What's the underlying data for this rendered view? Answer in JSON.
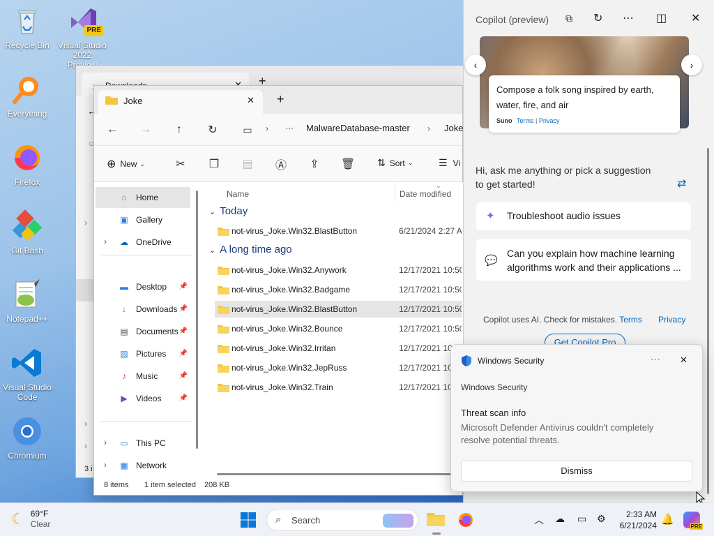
{
  "desktop": {
    "icons": [
      {
        "label": "Recycle Bin"
      },
      {
        "label": "Visual Studio 2022 Preview",
        "badge": "PRE"
      },
      {
        "label": "Everything"
      },
      {
        "label": "Firefox"
      },
      {
        "label": "Git Bash"
      },
      {
        "label": "Notepad++"
      },
      {
        "label": "Visual Studio Code"
      },
      {
        "label": "Chromium"
      }
    ]
  },
  "explorer_back": {
    "tab_title": "Downloads",
    "status_partial": "3 i"
  },
  "explorer": {
    "tab_title": "Joke",
    "breadcrumb": {
      "more": "···",
      "items": [
        "MalwareDatabase-master",
        "Joke"
      ]
    },
    "commands": {
      "new": "New",
      "sort": "Sort",
      "view": "Vi"
    },
    "nav": [
      {
        "label": "Home",
        "selected": true
      },
      {
        "label": "Gallery"
      },
      {
        "label": "OneDrive"
      },
      {
        "label": "Desktop",
        "pinned": true
      },
      {
        "label": "Downloads",
        "pinned": true
      },
      {
        "label": "Documents",
        "pinned": true
      },
      {
        "label": "Pictures",
        "pinned": true
      },
      {
        "label": "Music",
        "pinned": true
      },
      {
        "label": "Videos",
        "pinned": true
      },
      {
        "label": "This PC"
      },
      {
        "label": "Network"
      }
    ],
    "columns": {
      "name": "Name",
      "date": "Date modified"
    },
    "groups": [
      {
        "label": "Today",
        "files": [
          {
            "name": "not-virus_Joke.Win32.BlastButton",
            "date": "6/21/2024 2:27 AM"
          }
        ]
      },
      {
        "label": "A long time ago",
        "files": [
          {
            "name": "not-virus_Joke.Win32.Anywork",
            "date": "12/17/2021 10:50"
          },
          {
            "name": "not-virus_Joke.Win32.Badgame",
            "date": "12/17/2021 10:50"
          },
          {
            "name": "not-virus_Joke.Win32.BlastButton",
            "date": "12/17/2021 10:50",
            "selected": true
          },
          {
            "name": "not-virus_Joke.Win32.Bounce",
            "date": "12/17/2021 10:50"
          },
          {
            "name": "not-virus_Joke.Win32.Irritan",
            "date": "12/17/2021 10:50"
          },
          {
            "name": "not-virus_Joke.Win32.JepRuss",
            "date": "12/17/2021 10:50"
          },
          {
            "name": "not-virus_Joke.Win32.Train",
            "date": "12/17/2021 10:50"
          }
        ]
      }
    ],
    "status": {
      "count": "8 items",
      "selection": "1 item selected",
      "size": "208 KB"
    }
  },
  "copilot": {
    "title": "Copilot (preview)",
    "carousel": {
      "caption": "Compose a folk song inspired by earth, water, fire, and air",
      "brand": "Suno",
      "terms": "Terms",
      "sep": "|",
      "privacy": "Privacy"
    },
    "greeting": "Hi, ask me anything or pick a suggestion to get started!",
    "suggestions": [
      "Troubleshoot audio issues",
      "Can you explain how machine learning algorithms work and their applications ..."
    ],
    "disclaimer": "Copilot uses AI. Check for mistakes.",
    "terms": "Terms",
    "privacy": "Privacy",
    "pro_button": "Get Copilot Pro"
  },
  "toast": {
    "app": "Windows Security",
    "source": "Windows Security",
    "heading": "Threat scan info",
    "body": "Microsoft Defender Antivirus couldn't completely resolve potential threats.",
    "dismiss": "Dismiss",
    "more": "···"
  },
  "taskbar": {
    "weather": {
      "temp": "69°F",
      "cond": "Clear"
    },
    "search_placeholder": "Search",
    "clock": {
      "time": "2:33 AM",
      "date": "6/21/2024"
    },
    "colors": {
      "accent": "#0067c0"
    }
  }
}
